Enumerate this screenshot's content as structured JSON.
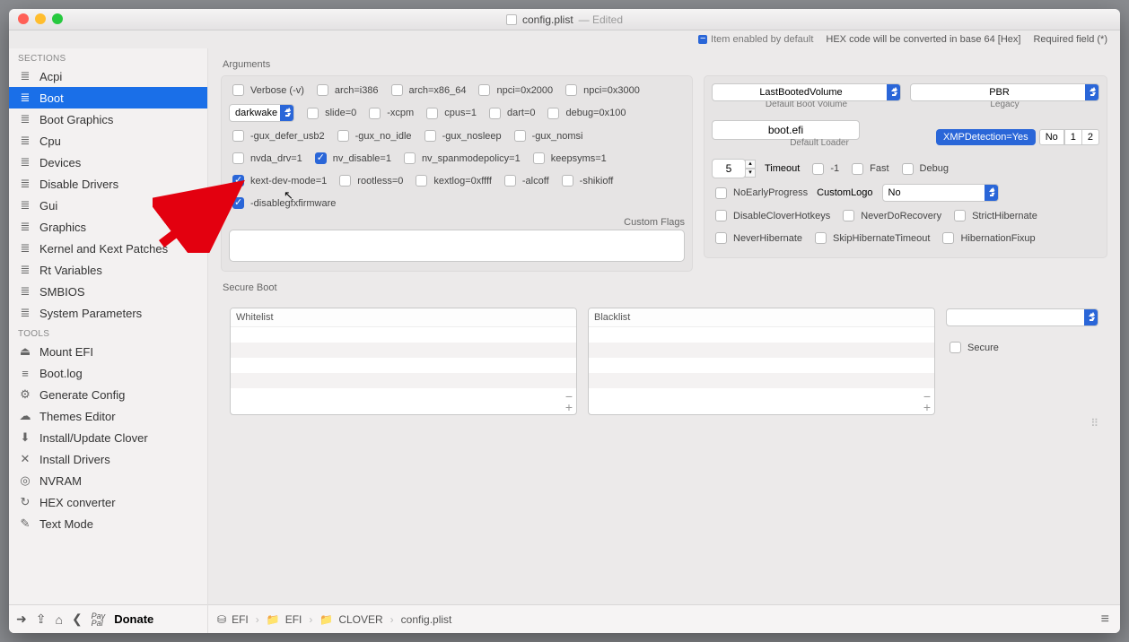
{
  "title": {
    "filename": "config.plist",
    "edited": "— Edited"
  },
  "infobar": {
    "enabled_by_default": "Item enabled by default",
    "hex_note": "HEX code will be converted in base 64 [Hex]",
    "required": "Required field (*)"
  },
  "sidebar": {
    "sections_label": "SECTIONS",
    "sections": [
      {
        "label": "Acpi"
      },
      {
        "label": "Boot"
      },
      {
        "label": "Boot Graphics"
      },
      {
        "label": "Cpu"
      },
      {
        "label": "Devices"
      },
      {
        "label": "Disable Drivers"
      },
      {
        "label": "Gui"
      },
      {
        "label": "Graphics"
      },
      {
        "label": "Kernel and Kext Patches"
      },
      {
        "label": "Rt Variables"
      },
      {
        "label": "SMBIOS"
      },
      {
        "label": "System Parameters"
      }
    ],
    "tools_label": "TOOLS",
    "tools": [
      {
        "label": "Mount EFI",
        "glyph": "⏏"
      },
      {
        "label": "Boot.log",
        "glyph": "≡"
      },
      {
        "label": "Generate Config",
        "glyph": "⚙"
      },
      {
        "label": "Themes Editor",
        "glyph": "☁"
      },
      {
        "label": "Install/Update Clover",
        "glyph": "⬇"
      },
      {
        "label": "Install Drivers",
        "glyph": "✕"
      },
      {
        "label": "NVRAM",
        "glyph": "◎"
      },
      {
        "label": "HEX converter",
        "glyph": "↻"
      },
      {
        "label": "Text Mode",
        "glyph": "✎"
      }
    ]
  },
  "footer_sb": {
    "donate": "Donate"
  },
  "args": {
    "heading": "Arguments",
    "darkwake_value": "darkwake",
    "items_row1": [
      "Verbose (-v)",
      "arch=i386",
      "arch=x86_64",
      "npci=0x2000",
      "npci=0x3000"
    ],
    "items_row2": [
      "slide=0",
      "-xcpm",
      "cpus=1",
      "dart=0",
      "debug=0x100"
    ],
    "items_row3": [
      "-gux_defer_usb2",
      "-gux_no_idle",
      "-gux_nosleep",
      "-gux_nomsi"
    ],
    "items_row4": [
      "nvda_drv=1",
      "nv_disable=1",
      "nv_spanmodepolicy=1",
      "keepsyms=1"
    ],
    "items_row5": [
      "kext-dev-mode=1",
      "rootless=0",
      "kextlog=0xffff",
      "-alcoff",
      "-shikioff"
    ],
    "items_row6": [
      "-disablegfxfirmware"
    ],
    "custom_flags_label": "Custom Flags"
  },
  "right": {
    "boot_volume": "LastBootedVolume",
    "boot_volume_under": "Default Boot Volume",
    "legacy": "PBR",
    "legacy_under": "Legacy",
    "loader": "boot.efi",
    "loader_under": "Default Loader",
    "xmp": "XMPDetection=Yes",
    "seg_no": "No",
    "seg_1": "1",
    "seg_2": "2",
    "timeout_value": "5",
    "timeout_label": "Timeout",
    "flags": [
      "-1",
      "Fast",
      "Debug"
    ],
    "row2": [
      "NoEarlyProgress"
    ],
    "customlogo_label": "CustomLogo",
    "customlogo_value": "No",
    "row3": [
      "DisableCloverHotkeys",
      "NeverDoRecovery",
      "StrictHibernate"
    ],
    "row4": [
      "NeverHibernate",
      "SkipHibernateTimeout",
      "HibernationFixup"
    ]
  },
  "sboot": {
    "heading": "Secure Boot",
    "whitelist": "Whitelist",
    "blacklist": "Blacklist",
    "secure": "Secure"
  },
  "path": {
    "p0": "EFI",
    "p1": "EFI",
    "p2": "CLOVER",
    "p3": "config.plist"
  }
}
